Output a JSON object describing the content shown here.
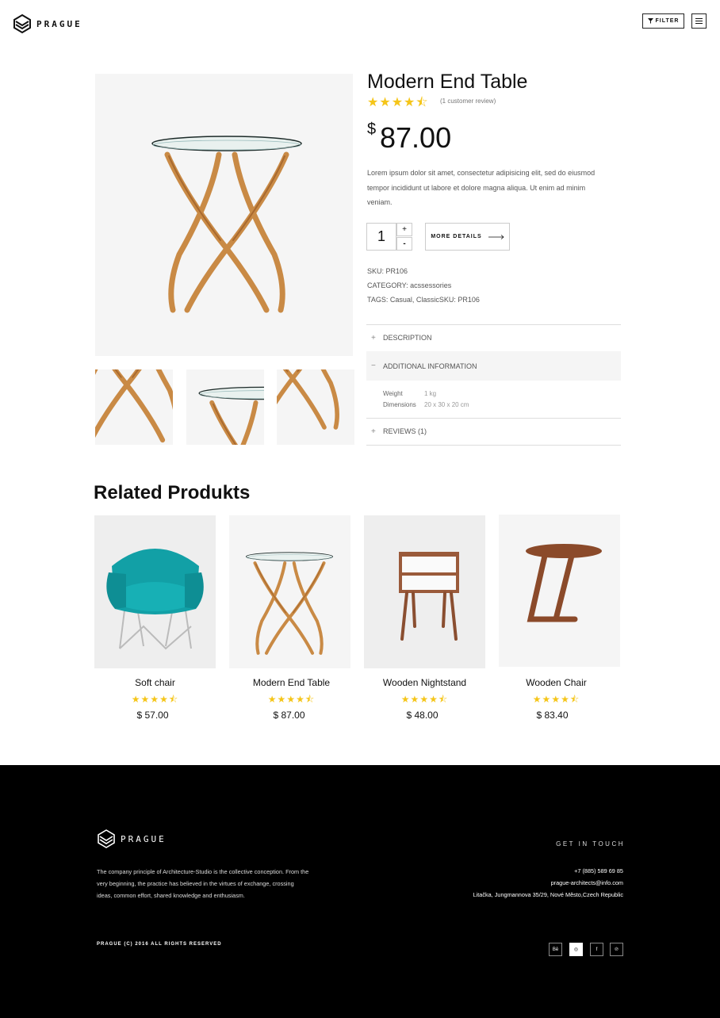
{
  "brand": {
    "name": "PRAGUE"
  },
  "header": {
    "filter_label": "FILTER"
  },
  "product": {
    "title": "Modern End Table",
    "rating_stars": "★★★★⯪",
    "rating": 4.5,
    "review_text": "(1 customer review)",
    "currency": "$",
    "price": "87.00",
    "description": "Lorem ipsum dolor sit amet, consectetur adipisicing elit, sed do eiusmod tempor incididunt ut labore et dolore magna aliqua. Ut enim ad minim veniam.",
    "quantity": "1",
    "qty_plus": "+",
    "qty_minus": "-",
    "more_details_label": "MORE DETAILS",
    "sku": "SKU: PR106",
    "category": "CATEGORY: acssessories",
    "tags": "TAGS: Casual, ClassicSKU: PR106"
  },
  "accordion": {
    "description": {
      "sign": "+",
      "label": "DESCRIPTION"
    },
    "additional": {
      "sign": "−",
      "label": "ADDITIONAL INFORMATION",
      "specs": [
        {
          "key": "Weight",
          "value": "1 kg"
        },
        {
          "key": "Dimensions",
          "value": "20 x 30 x 20 cm"
        }
      ]
    },
    "reviews": {
      "sign": "+",
      "label": "REVIEWS (1)"
    }
  },
  "related": {
    "title": "Related Produkts",
    "items": [
      {
        "name": "Soft chair",
        "stars": "★★★★⯪",
        "rating": 4.5,
        "price": "$ 57.00"
      },
      {
        "name": "Modern End Table",
        "stars": "★★★★⯪",
        "rating": 4.5,
        "price": "$ 87.00"
      },
      {
        "name": "Wooden Nightstand",
        "stars": "★★★★⯪",
        "rating": 4.5,
        "price": "$ 48.00"
      },
      {
        "name": "Wooden Chair",
        "stars": "★★★★⯪",
        "rating": 4.5,
        "price": "$ 83.40"
      }
    ]
  },
  "footer": {
    "brand": "PRAGUE",
    "about": "The company principle of Architecture-Studio is the collective conception. From the very beginning, the practice has believed in the virtues of exchange, crossing ideas, common effort, shared knowledge and enthusiasm.",
    "get_in_touch": "GET IN TOUCH",
    "phone": "+7 (885) 589 69 85",
    "email": "prague-architects@info.com",
    "address": "Litačka, Jungmannova 35/29, Nové Město,Czech Republic",
    "copyright": "PRAGUE (C) 2016 ALL RIGHTS RESERVED",
    "social": [
      {
        "label": "Bē",
        "icon": "behance-icon"
      },
      {
        "label": "◎",
        "icon": "dribbble-icon"
      },
      {
        "label": "f",
        "icon": "facebook-icon"
      },
      {
        "label": "℗",
        "icon": "pinterest-icon"
      }
    ]
  },
  "colors": {
    "star": "#f5c518",
    "footer_bg": "#000000",
    "image_bg": "#f5f5f5"
  }
}
